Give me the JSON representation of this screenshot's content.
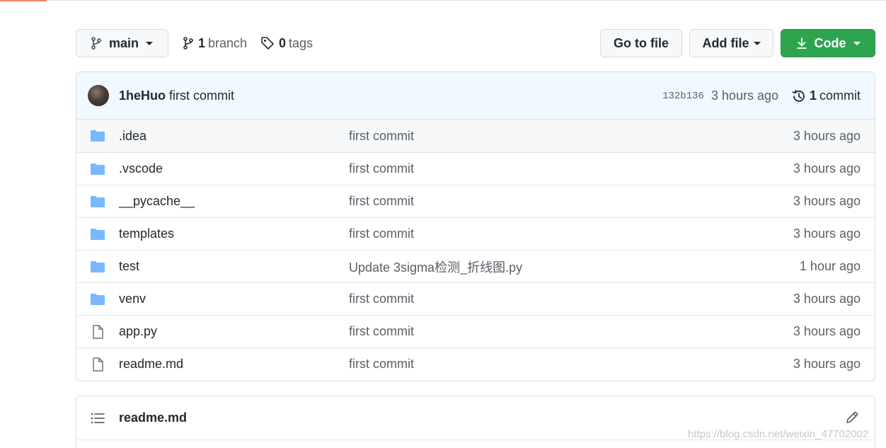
{
  "toolbar": {
    "branch_name": "main",
    "branch_count": "1",
    "branch_label": "branch",
    "tag_count": "0",
    "tag_label": "tags",
    "go_to_file": "Go to file",
    "add_file": "Add file",
    "code": "Code"
  },
  "commit": {
    "author": "1heHuo",
    "message": "first commit",
    "sha": "132b136",
    "time": "3 hours ago",
    "count": "1",
    "count_label": "commit"
  },
  "files": [
    {
      "type": "folder",
      "name": ".idea",
      "message": "first commit",
      "age": "3 hours ago"
    },
    {
      "type": "folder",
      "name": ".vscode",
      "message": "first commit",
      "age": "3 hours ago"
    },
    {
      "type": "folder",
      "name": "__pycache__",
      "message": "first commit",
      "age": "3 hours ago"
    },
    {
      "type": "folder",
      "name": "templates",
      "message": "first commit",
      "age": "3 hours ago"
    },
    {
      "type": "folder",
      "name": "test",
      "message": "Update 3sigma检测_折线图.py",
      "age": "1 hour ago"
    },
    {
      "type": "folder",
      "name": "venv",
      "message": "first commit",
      "age": "3 hours ago"
    },
    {
      "type": "file",
      "name": "app.py",
      "message": "first commit",
      "age": "3 hours ago"
    },
    {
      "type": "file",
      "name": "readme.md",
      "message": "first commit",
      "age": "3 hours ago"
    }
  ],
  "readme": {
    "title": "readme.md"
  },
  "watermark": "https://blog.csdn.net/weixin_47702002",
  "colors": {
    "accent_green": "#2ea44f",
    "folder_blue": "#79b8ff",
    "commit_bar_bg": "#f1f8ff"
  }
}
